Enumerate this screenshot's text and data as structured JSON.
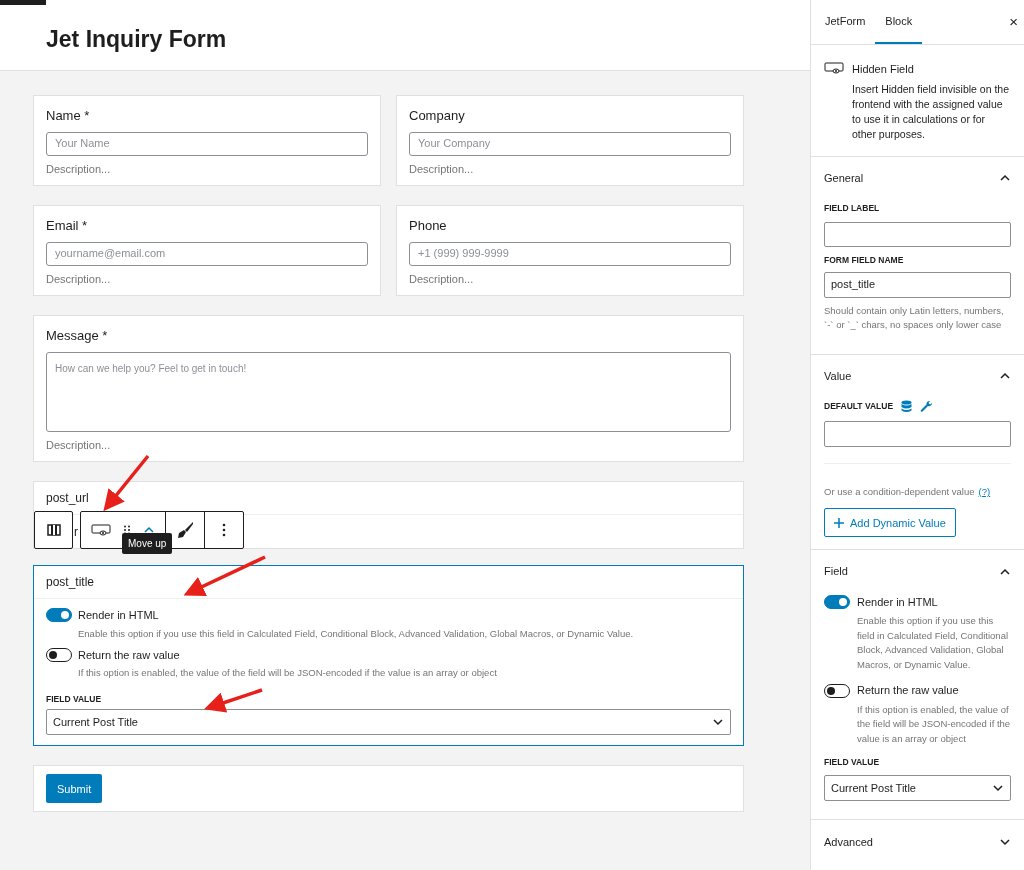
{
  "title": "Jet Inquiry Form",
  "field_rows": [
    [
      {
        "kind": "input",
        "label": "Name *",
        "placeholder": "Your Name",
        "description": "Description..."
      },
      {
        "kind": "input",
        "label": "Company",
        "placeholder": "Your Company",
        "description": "Description..."
      }
    ],
    [
      {
        "kind": "input",
        "label": "Email *",
        "placeholder": "yourname@email.com",
        "description": "Description..."
      },
      {
        "kind": "input",
        "label": "Phone",
        "placeholder": "+1 (999) 999-9999",
        "description": "Description..."
      }
    ],
    [
      {
        "kind": "textarea",
        "label": "Message *",
        "placeholder": "How can we help you? Feel to get in touch!",
        "description": "Description..."
      }
    ]
  ],
  "hidden_block": {
    "rows": [
      {
        "label": "post_url"
      },
      {
        "label": "r"
      }
    ]
  },
  "block_toolbar": {
    "tooltip": "Move up"
  },
  "selected_block": {
    "name": "post_title",
    "selected": true,
    "toggles": [
      {
        "label": "Render in HTML",
        "on": true,
        "description": "Enable this option if you use this field in Calculated Field, Conditional Block, Advanced Validation, Global Macros, or Dynamic Value."
      },
      {
        "label": "Return the raw value",
        "on": false,
        "description": "If this option is enabled, the value of the field will be JSON-encoded if the value is an array or object"
      }
    ],
    "field_value_label": "FIELD VALUE",
    "field_value": "Current Post Title"
  },
  "submit": "Submit",
  "sidebar": {
    "tabs": [
      {
        "label": "JetForm",
        "selected": false
      },
      {
        "label": "Block",
        "selected": true
      }
    ],
    "close": "×",
    "block": {
      "title": "Hidden Field",
      "description": "Insert Hidden field invisible on the frontend with the assigned value to use it in calculations or for other purposes."
    },
    "general": {
      "title": "General",
      "expanded": true,
      "field_label": "FIELD LABEL",
      "form_field_name": "FORM FIELD NAME",
      "form_field_name_value": "post_title",
      "hint": "Should contain only Latin letters, numbers, `-` or `_` chars, no spaces only lower case"
    },
    "value": {
      "title": "Value",
      "expanded": true,
      "default_value": "DEFAULT VALUE",
      "condition_text": "Or use a condition-dependent value",
      "help_link": "(?)",
      "add_button": "Add Dynamic Value"
    },
    "field": {
      "title": "Field",
      "expanded": true,
      "toggles": [
        {
          "label": "Render in HTML",
          "on": true,
          "description": "Enable this option if you use this field in Calculated Field, Conditional Block, Advanced Validation, Global Macros, or Dynamic Value."
        },
        {
          "label": "Return the raw value",
          "on": false,
          "description": "If this option is enabled, the value of the field will be JSON-encoded if the value is an array or object"
        }
      ],
      "field_value_label": "FIELD VALUE",
      "field_value": "Current Post Title"
    },
    "advanced": {
      "title": "Advanced",
      "expanded": false
    }
  }
}
